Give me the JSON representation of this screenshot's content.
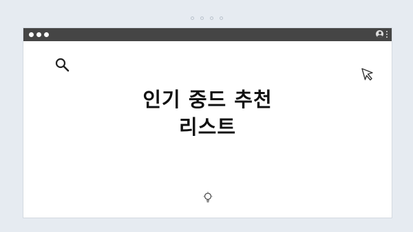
{
  "window": {
    "headline_line1": "인기 중드 추천",
    "headline_line2": "리스트"
  },
  "icons": {
    "search": "search-icon",
    "cursor": "cursor-icon",
    "bulb": "lightbulb-icon",
    "user": "user-icon",
    "menu": "more-vertical-icon"
  },
  "colors": {
    "background": "#e6ebf1",
    "titlebar": "#454545",
    "window": "#ffffff",
    "text": "#111111"
  }
}
